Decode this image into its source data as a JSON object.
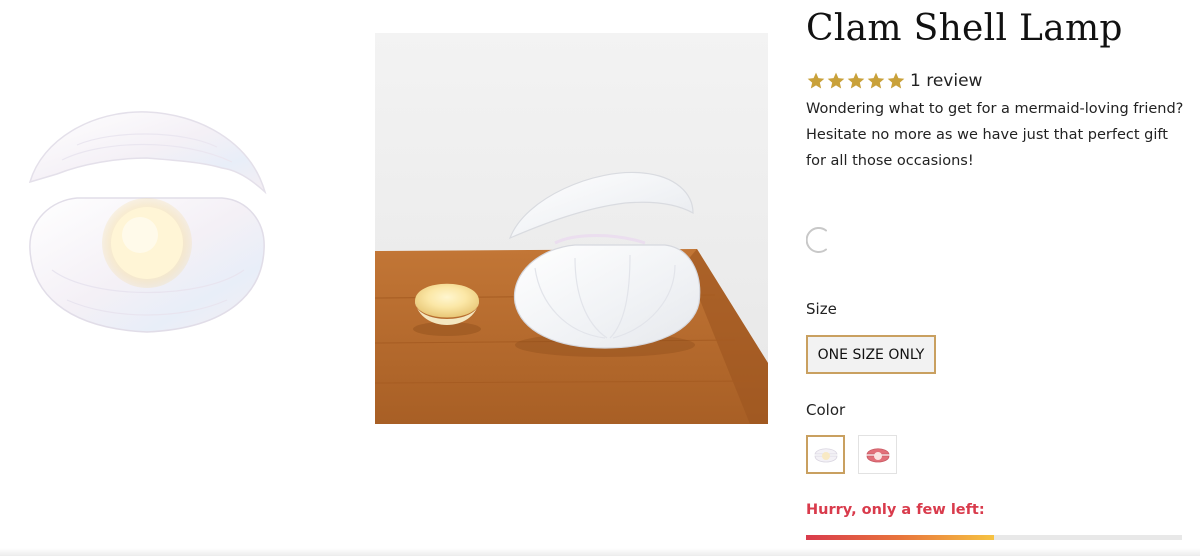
{
  "product": {
    "title": "Clam Shell Lamp",
    "rating": {
      "stars": 5,
      "max_stars": 5,
      "review_text": "1 review"
    },
    "description": "Wondering what to get for a mermaid-loving friend? Hesitate no more as we have just that perfect gift for all those occasions!",
    "size": {
      "label": "Size",
      "selected": "ONE SIZE ONLY"
    },
    "color": {
      "label": "Color",
      "options": [
        "white-pearl",
        "pink-pearl"
      ],
      "selected": "white-pearl"
    },
    "stock": {
      "message": "Hurry, only a few left:",
      "level_fraction": 0.5
    }
  },
  "colors": {
    "star": "#c9a13a",
    "accent_border": "#c9a060",
    "urgency": "#d93b4c",
    "wood": "#b86a2e"
  },
  "icons": {
    "star": "star-icon",
    "spinner": "loading-spinner-icon"
  }
}
